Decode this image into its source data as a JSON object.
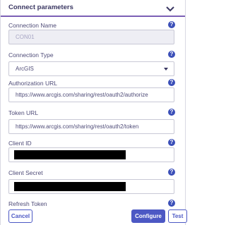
{
  "section": {
    "title": "Connect parameters"
  },
  "fields": {
    "connection_name": {
      "label": "Connection Name",
      "value": "CON01"
    },
    "connection_type": {
      "label": "Connection Type",
      "value": "ArcGIS"
    },
    "authorization_url": {
      "label": "Authorization URL",
      "value": "https://www.arcgis.com/sharing/rest/oauth2/authorize"
    },
    "token_url": {
      "label": "Token URL",
      "value": "https://www.arcgis.com/sharing/rest/oauth2/token"
    },
    "client_id": {
      "label": "Client ID"
    },
    "client_secret": {
      "label": "Client Secret"
    },
    "refresh_token": {
      "label": "Refresh Token"
    }
  },
  "help_glyph": "?",
  "buttons": {
    "cancel": "Cancel",
    "configure": "Configure",
    "test": "Test"
  },
  "colors": {
    "accent": "#4c58c4",
    "header_underline": "#7b5fb5",
    "help_icon": "#3b4fb8",
    "redaction": "#000000"
  }
}
